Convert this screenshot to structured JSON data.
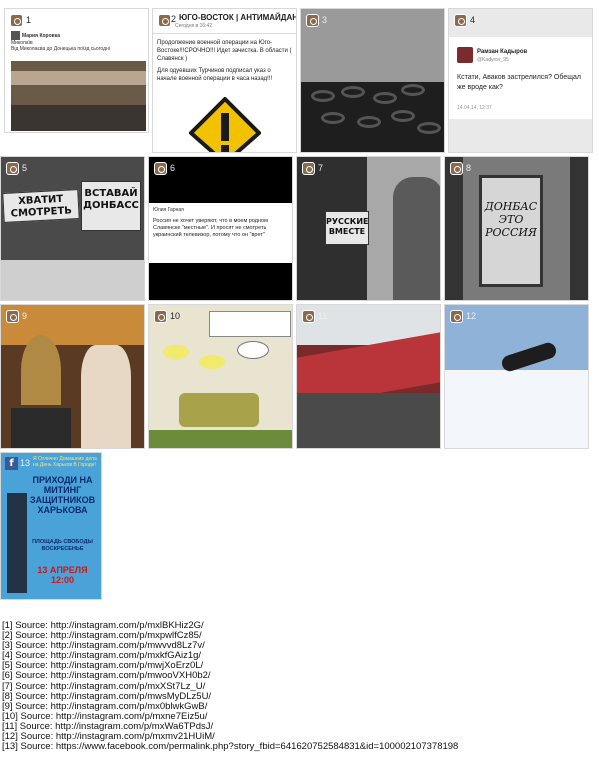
{
  "tiles": [
    {
      "num": "1",
      "type": "instagram",
      "fb_name": "Мария Коровка",
      "fb_caption": "Миколаїв",
      "fb_line": "Від Миколаєва до Донецька поїзд сьогодні"
    },
    {
      "num": "2",
      "type": "instagram",
      "title": "ЮГО-ВОСТОК | АНТИМАЙДАН",
      "subtitle": "Сегодня в 16:42",
      "text": "Продолжение военной операции на Юго-Востоке!!!СРОЧНО!!! Идет зачистка. В области ( Славянск )",
      "text2": "Для одуевших Турчинов подписал указ о начале военной операции в часа назад!!!"
    },
    {
      "num": "3",
      "type": "instagram"
    },
    {
      "num": "4",
      "type": "instagram",
      "name": "Рамзан Кадыров",
      "handle": "@Kadyrov_95",
      "tweet": "Кстати, Аваков застрелился? Обещал же вроде как?",
      "date": "14.04.14, 12:37"
    },
    {
      "num": "5",
      "type": "instagram",
      "sign_left": "ХВАТИТ СМОТРЕТЬ",
      "sign_right": "ВСТАВАЙ ДОНБАСС"
    },
    {
      "num": "6",
      "type": "instagram",
      "name": "Юлия Гарная",
      "text": "Россия не хочет уверяют, что в моем родном Славянске \"местные\". И просят не смотреть украинский телевизор, потому что он \"врет\""
    },
    {
      "num": "7",
      "type": "instagram",
      "sign": "РУССКИЕ ВМЕСТЕ"
    },
    {
      "num": "8",
      "type": "instagram",
      "poster": "ДОНБАС ЭТО РОССИЯ"
    },
    {
      "num": "9",
      "type": "instagram"
    },
    {
      "num": "10",
      "type": "instagram"
    },
    {
      "num": "11",
      "type": "instagram"
    },
    {
      "num": "12",
      "type": "instagram"
    },
    {
      "num": "13",
      "type": "facebook",
      "top": "Я Отлично Домашние дела на День Харьков В Городе!",
      "head": "ПРИХОДИ НА МИТИНГ ЗАЩИТНИКОВ ХАРЬКОВА",
      "place": "ПЛОЩАДЬ СВОБОДЫ ВОСКРЕСЕНЬЕ",
      "date": "13 АПРЕЛЯ",
      "time": "12:00"
    }
  ],
  "sources": [
    "[1] Source: http://instagram.com/p/mxlBKHiz2G/",
    "[2] Source: http://instagram.com/p/mxpwlfCz85/",
    "[3] Source: http://instagram.com/p/mwvvd8Lz7v/",
    "[4] Source: http://instagram.com/p/mxkfGAiz1g/",
    "[5] Source: http://instagram.com/p/mwjXoErz0L/",
    "[6] Source: http://instagram.com/p/mwooVXH0b2/",
    "[7] Source: http://instagram.com/p/mxXSt7Lz_U/",
    "[8] Source: http://instagram.com/p/mwsMyDLz5U/",
    "[9] Source: http://instagram.com/p/mx0blwkGwB/",
    "[10] Source: http://instagram.com/p/mxne7Eiz5u/",
    "[11] Source: http://instagram.com/p/mxWa6TPdsJ/",
    "[12] Source: http://instagram.com/p/mxmv21HUiM/",
    "[13] Source: https://www.facebook.com/permalink.php?story_fbid=641620752584831&id=100002107378198"
  ],
  "colors": {
    "facebook": "#3b5998",
    "warning_yellow": "#f2c200",
    "poster_red": "#d01616"
  }
}
